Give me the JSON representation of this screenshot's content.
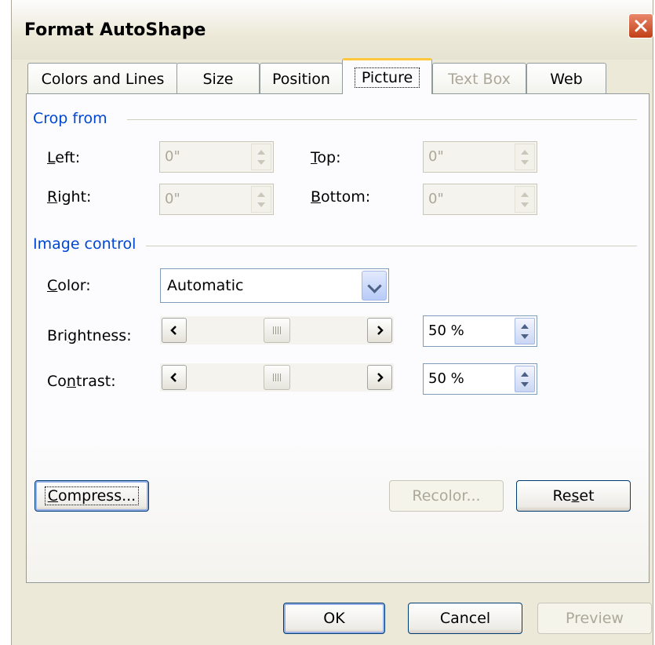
{
  "window": {
    "title": "Format AutoShape"
  },
  "tabs": [
    {
      "label": "Colors and Lines",
      "state": "normal"
    },
    {
      "label": "Size",
      "state": "normal"
    },
    {
      "label": "Position",
      "state": "normal"
    },
    {
      "label": "Picture",
      "state": "active"
    },
    {
      "label": "Text Box",
      "state": "disabled"
    },
    {
      "label": "Web",
      "state": "normal"
    }
  ],
  "crop": {
    "group_label": "Crop from",
    "left": {
      "label_pre": "",
      "label_u": "L",
      "label_post": "eft:",
      "value": "0\""
    },
    "top": {
      "label_pre": "",
      "label_u": "T",
      "label_post": "op:",
      "value": "0\""
    },
    "right": {
      "label_pre": "",
      "label_u": "R",
      "label_post": "ight:",
      "value": "0\""
    },
    "bottom": {
      "label_pre": "",
      "label_u": "B",
      "label_post": "ottom:",
      "value": "0\""
    }
  },
  "image_control": {
    "group_label": "Image control",
    "color": {
      "label_pre": "",
      "label_u": "C",
      "label_post": "olor:",
      "value": "Automatic"
    },
    "brightness": {
      "label_pre": "Bri",
      "label_u": "g",
      "label_post": "htness:",
      "value": "50 %",
      "level": 0.5
    },
    "contrast": {
      "label_pre": "Co",
      "label_u": "n",
      "label_post": "trast:",
      "value": "50 %",
      "level": 0.5
    }
  },
  "actions": {
    "compress": {
      "pre": "",
      "u": "C",
      "post": "ompress..."
    },
    "recolor": "Recolor...",
    "reset": {
      "pre": "Re",
      "u": "s",
      "post": "et"
    }
  },
  "footer": {
    "ok": "OK",
    "cancel": "Cancel",
    "preview": "Preview"
  },
  "colors": {
    "group_label": "#0046d5",
    "active_tab_accent": "#ffc83c",
    "close_button": "#c13f16"
  }
}
